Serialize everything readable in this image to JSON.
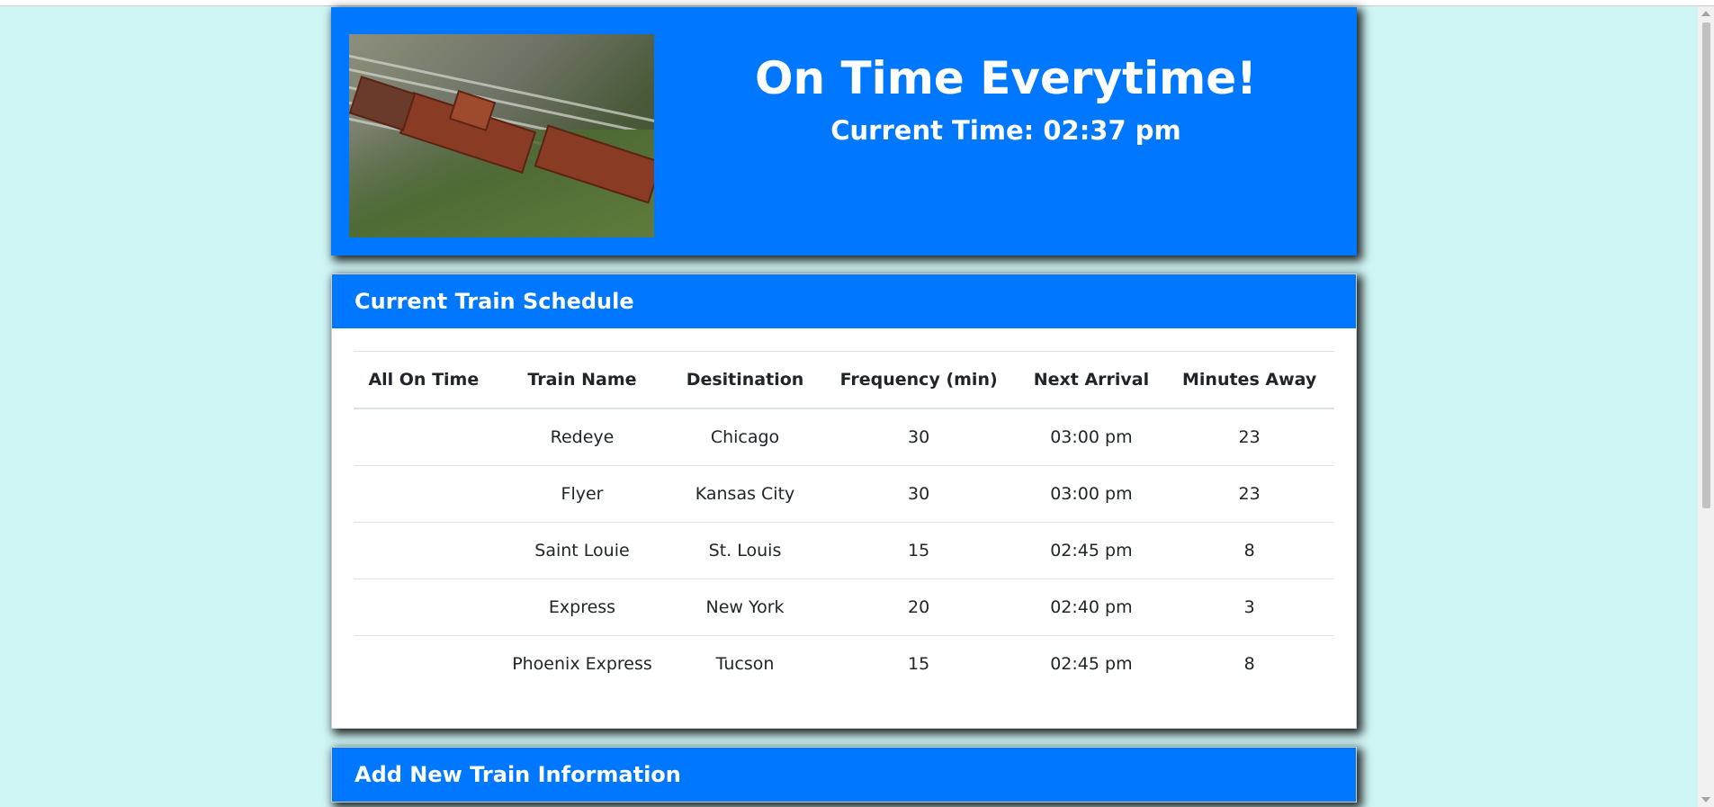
{
  "header": {
    "title": "On Time Everytime!",
    "current_time_label": "Current Time: 02:37 pm",
    "image_icon": "train-photo"
  },
  "schedule": {
    "title": "Current Train Schedule",
    "columns": [
      "All On Time",
      "Train Name",
      "Desitination",
      "Frequency (min)",
      "Next Arrival",
      "Minutes Away"
    ],
    "rows": [
      {
        "all": "",
        "name": "Redeye",
        "destination": "Chicago",
        "frequency": "30",
        "next_arrival": "03:00 pm",
        "minutes_away": "23"
      },
      {
        "all": "",
        "name": "Flyer",
        "destination": "Kansas City",
        "frequency": "30",
        "next_arrival": "03:00 pm",
        "minutes_away": "23"
      },
      {
        "all": "",
        "name": "Saint Louie",
        "destination": "St. Louis",
        "frequency": "15",
        "next_arrival": "02:45 pm",
        "minutes_away": "8"
      },
      {
        "all": "",
        "name": "Express",
        "destination": "New York",
        "frequency": "20",
        "next_arrival": "02:40 pm",
        "minutes_away": "3"
      },
      {
        "all": "",
        "name": "Phoenix Express",
        "destination": "Tucson",
        "frequency": "15",
        "next_arrival": "02:45 pm",
        "minutes_away": "8"
      }
    ]
  },
  "add_train": {
    "title": "Add New Train Information"
  },
  "colors": {
    "page_background": "#d0f5f5",
    "accent": "#0077ff"
  }
}
